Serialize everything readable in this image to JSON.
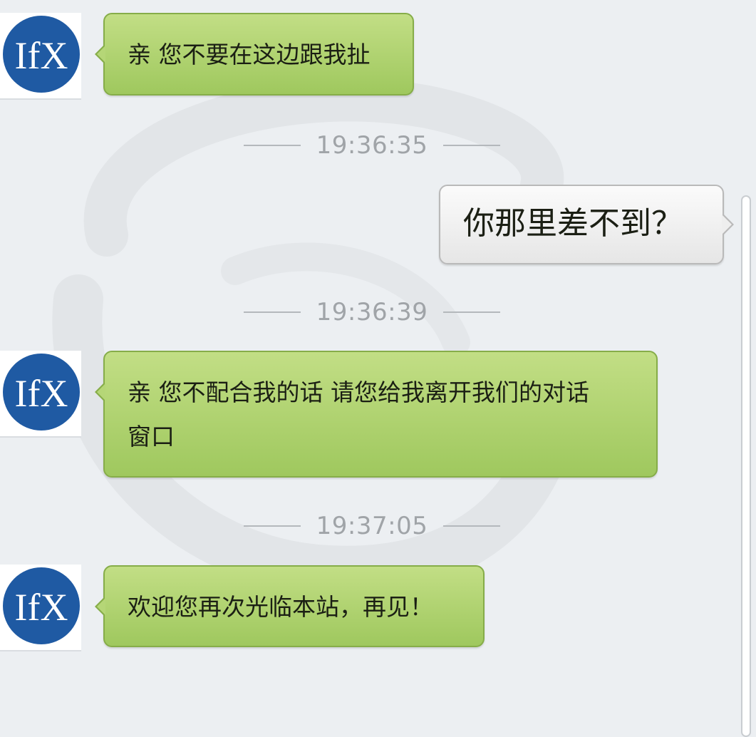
{
  "messages": [
    {
      "from": "agent",
      "text": "亲 您不要在这边跟我扯"
    },
    {
      "time": "19:36:35"
    },
    {
      "from": "user",
      "text": "你那里差不到？"
    },
    {
      "time": "19:36:39"
    },
    {
      "from": "agent",
      "text_line1": "亲 您不配合我的话 请您给我离开我们的对话",
      "text_line2": "窗口"
    },
    {
      "time": "19:37:05"
    },
    {
      "from": "agent",
      "text": "欢迎您再次光临本站，再见！"
    }
  ],
  "avatar": {
    "icon": "ifx-logo-icon",
    "logo_text": "IfX"
  },
  "colors": {
    "agent_bubble": "#b3d575",
    "user_bubble": "#f0f0f0",
    "background": "#eceff2",
    "logo_blue": "#1f5aa3"
  }
}
